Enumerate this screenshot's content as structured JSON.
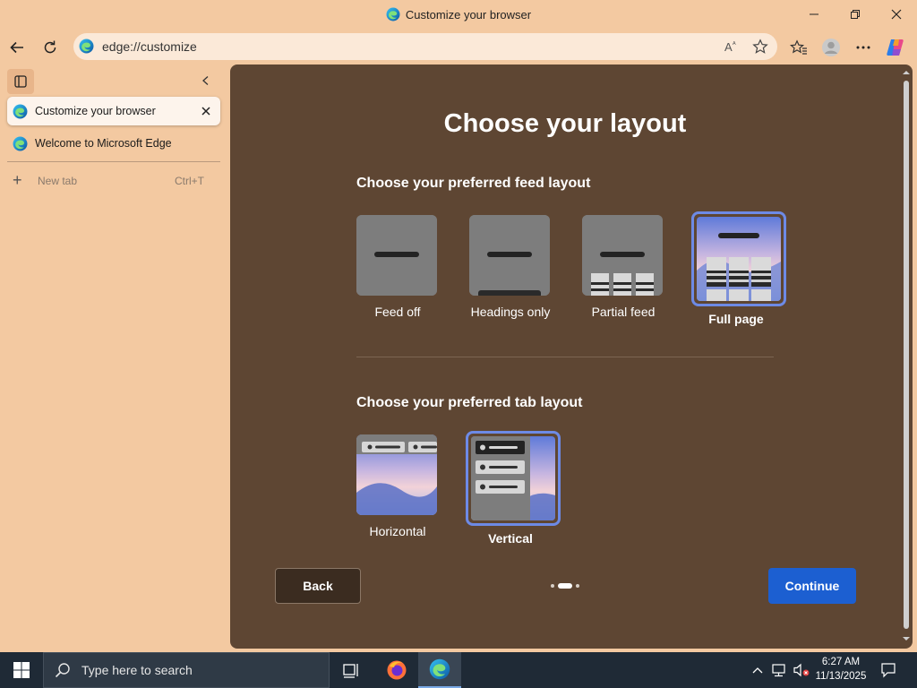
{
  "window": {
    "title": "Customize your browser",
    "controls": [
      "minimize",
      "restore",
      "close"
    ]
  },
  "address_bar": {
    "url": "edge://customize",
    "icons": [
      "read-aloud-icon",
      "favorite-star-icon"
    ]
  },
  "toolbar": {
    "icons": [
      "back-icon",
      "refresh-icon",
      "favorites-icon",
      "profile-icon",
      "more-icon",
      "copilot-icon"
    ]
  },
  "sidebar": {
    "tabs": [
      {
        "label": "Customize your browser",
        "active": true
      },
      {
        "label": "Welcome to Microsoft Edge",
        "active": false
      }
    ],
    "new_tab": {
      "label": "New tab",
      "shortcut": "Ctrl+T"
    }
  },
  "page": {
    "title": "Choose your layout",
    "feed_section": {
      "title": "Choose your preferred feed layout",
      "options": [
        {
          "label": "Feed off",
          "selected": false
        },
        {
          "label": "Headings only",
          "selected": false
        },
        {
          "label": "Partial feed",
          "selected": false
        },
        {
          "label": "Full page",
          "selected": true
        }
      ]
    },
    "tab_section": {
      "title": "Choose your preferred tab layout",
      "options": [
        {
          "label": "Horizontal",
          "selected": false
        },
        {
          "label": "Vertical",
          "selected": true
        }
      ]
    },
    "back_label": "Back",
    "continue_label": "Continue",
    "progress": {
      "steps": 3,
      "current": 2
    }
  },
  "taskbar": {
    "search_placeholder": "Type here to search",
    "time": "6:27 AM",
    "date": "11/13/2025"
  },
  "colors": {
    "accent": "#1c5fd1",
    "selection_border": "#6d8ae6",
    "content_bg": "#5e4633",
    "chrome_bg": "#f3c9a1"
  }
}
